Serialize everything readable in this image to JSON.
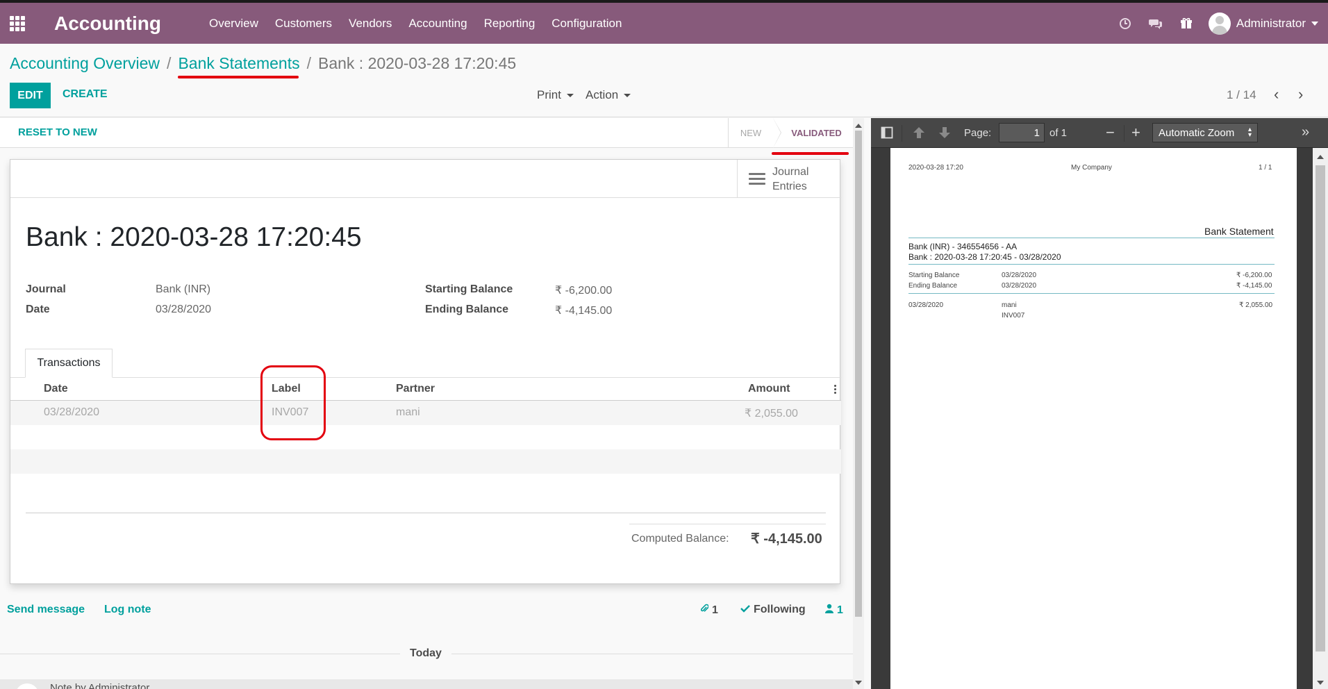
{
  "navbar": {
    "brand": "Accounting",
    "menu": [
      "Overview",
      "Customers",
      "Vendors",
      "Accounting",
      "Reporting",
      "Configuration"
    ],
    "user": "Administrator",
    "icons": [
      "clock-icon",
      "chat-icon",
      "gift-icon"
    ]
  },
  "breadcrumb": {
    "items": [
      "Accounting Overview",
      "Bank Statements"
    ],
    "current": "Bank : 2020-03-28 17:20:45",
    "separator": "/"
  },
  "toolbar": {
    "edit": "EDIT",
    "create": "CREATE",
    "print": "Print",
    "action": "Action",
    "pager": "1 / 14"
  },
  "statusbar": {
    "reset": "RESET TO NEW",
    "stages": [
      "NEW",
      "VALIDATED"
    ],
    "active": "VALIDATED"
  },
  "form": {
    "smart_button": [
      "Journal",
      "Entries"
    ],
    "title": "Bank : 2020-03-28 17:20:45",
    "journal_label": "Journal",
    "journal_value": "Bank (INR)",
    "date_label": "Date",
    "date_value": "03/28/2020",
    "starting_label": "Starting Balance",
    "starting_value": "₹ -6,200.00",
    "ending_label": "Ending Balance",
    "ending_value": "₹ -4,145.00",
    "tab": "Transactions",
    "columns": [
      "Date",
      "Label",
      "Partner",
      "Amount"
    ],
    "rows": [
      {
        "date": "03/28/2020",
        "label": "INV007",
        "partner": "mani",
        "amount": "₹ 2,055.00"
      }
    ],
    "computed_label": "Computed Balance:",
    "computed_value": "₹ -4,145.00"
  },
  "chatter": {
    "send_message": "Send message",
    "log_note": "Log note",
    "attachments": "1",
    "following": "Following",
    "followers": "1",
    "today": "Today",
    "bottom_text": "Note by Administrator"
  },
  "pdf_viewer": {
    "page_label": "Page:",
    "page_value": "1",
    "of": "of 1",
    "zoom": "Automatic Zoom",
    "doc": {
      "header_date": "2020-03-28 17:20",
      "company": "My Company",
      "page": "1 / 1",
      "title": "Bank Statement",
      "account": "Bank (INR) - 346554656 - AA",
      "statement": "Bank : 2020-03-28 17:20:45 - 03/28/2020",
      "starting_label": "Starting Balance",
      "starting_date": "03/28/2020",
      "starting_value": "₹ -6,200.00",
      "ending_label": "Ending Balance",
      "ending_date": "03/28/2020",
      "ending_value": "₹ -4,145.00",
      "line_date": "03/28/2020",
      "line_partner": "mani",
      "line_ref": "INV007",
      "line_amount": "₹ 2,055.00"
    }
  },
  "colors": {
    "brand": "#875a7b",
    "accent": "#00a09d",
    "annotation": "#e3000f"
  }
}
